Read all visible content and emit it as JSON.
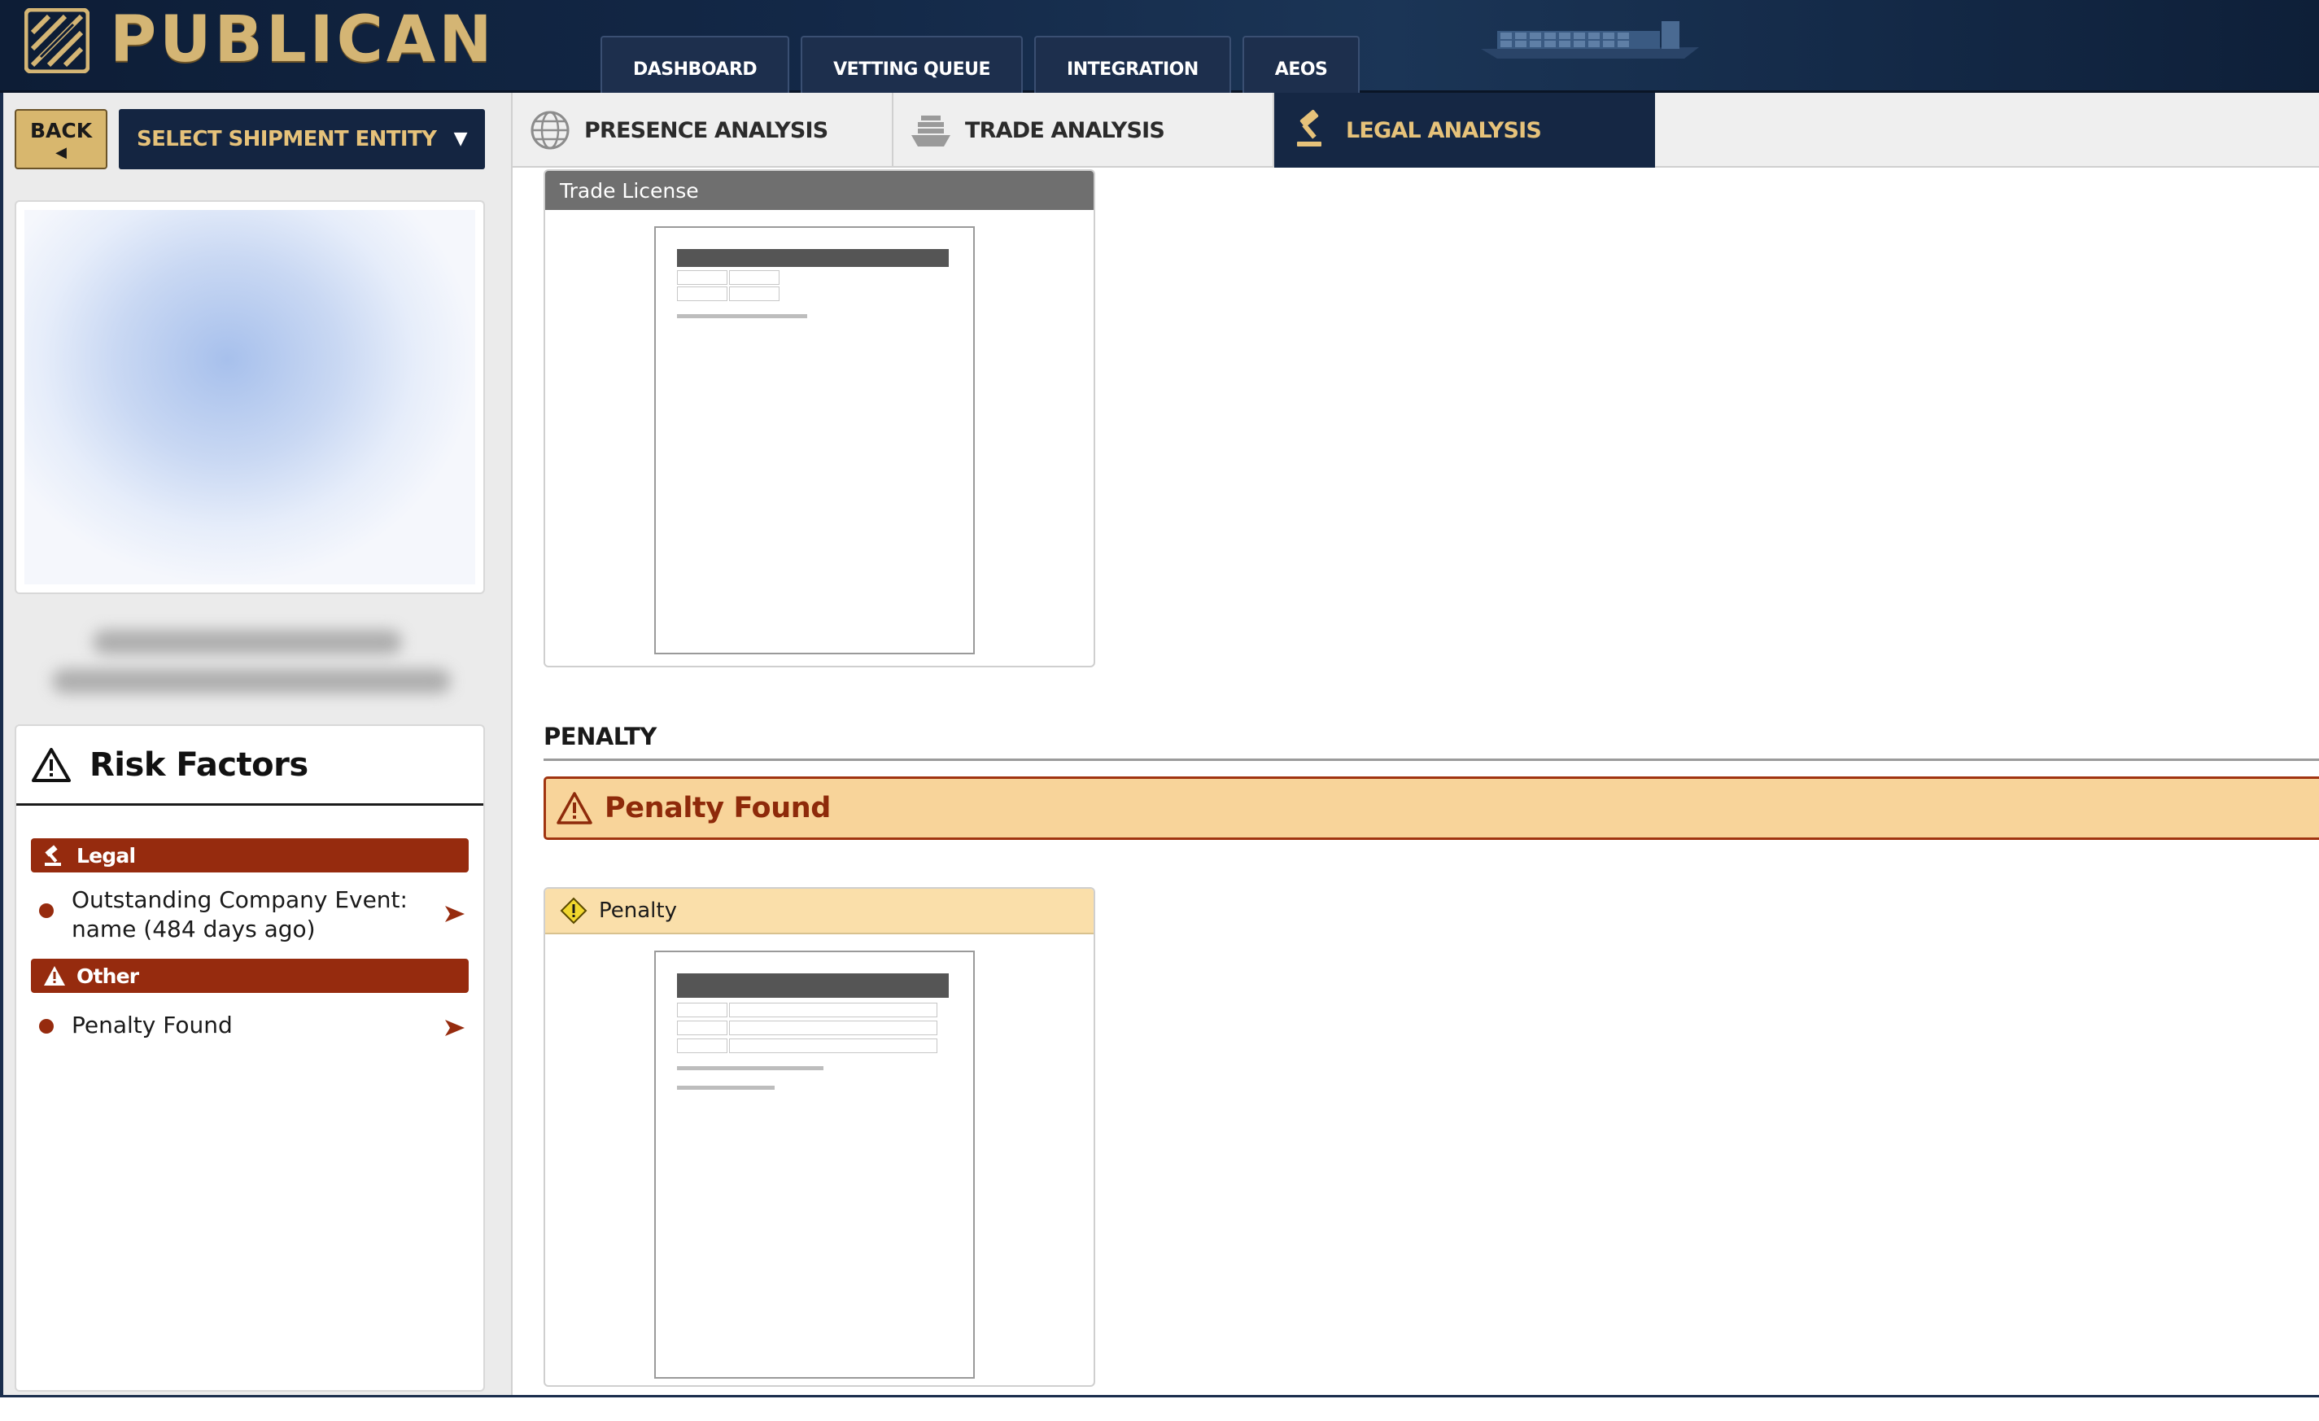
{
  "app": {
    "brand": "PUBLICAN",
    "colors": {
      "navy": "#142541",
      "gold": "#d8b76e",
      "risk_red": "#962b0e",
      "alert_bg": "#f8d49a"
    }
  },
  "nav": {
    "tabs": [
      {
        "label": "DASHBOARD"
      },
      {
        "label": "VETTING QUEUE"
      },
      {
        "label": "INTEGRATION"
      },
      {
        "label": "AEOS"
      }
    ]
  },
  "sidebar": {
    "back_label": "BACK",
    "back_icon": "triangle-left-icon",
    "select_entity_label": "SELECT SHIPMENT ENTITY",
    "select_caret_icon": "chevron-down-icon",
    "risk_factors": {
      "title": "Risk Factors",
      "icon": "warning-triangle-icon",
      "categories": [
        {
          "label": "Legal",
          "icon": "gavel-icon",
          "items": [
            {
              "text": "Outstanding Company Event: name (484 days ago)"
            }
          ]
        },
        {
          "label": "Other",
          "icon": "warning-triangle-icon",
          "items": [
            {
              "text": "Penalty Found"
            }
          ]
        }
      ]
    }
  },
  "analysis_tabs": [
    {
      "label": "PRESENCE ANALYSIS",
      "icon": "globe-icon",
      "active": false
    },
    {
      "label": "TRADE ANALYSIS",
      "icon": "cargo-ship-icon",
      "active": false
    },
    {
      "label": "LEGAL ANALYSIS",
      "icon": "gavel-icon",
      "active": true
    }
  ],
  "main": {
    "trade_license": {
      "title": "Trade License"
    },
    "penalty_section": {
      "heading": "PENALTY",
      "alert": "Penalty Found",
      "card_title": "Penalty"
    }
  }
}
